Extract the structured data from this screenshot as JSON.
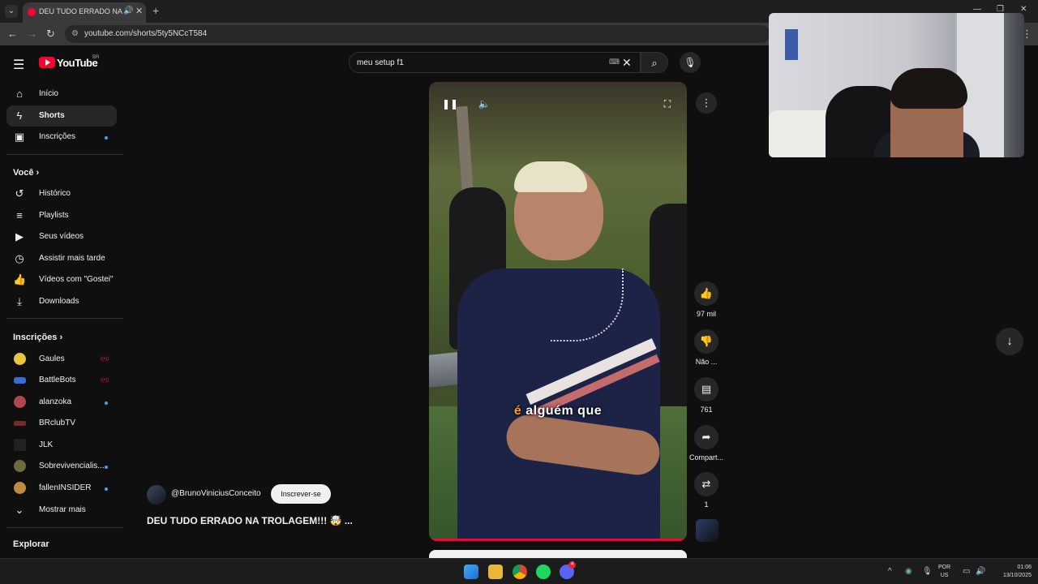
{
  "browser": {
    "tab_title": "DEU TUDO ERRADO NA TROLAGEM!!! - YouTube",
    "tab_title_visible": "DEU TUDO ERRADO NA TR",
    "url": "youtube.com/shorts/5ty5NCcT584"
  },
  "header": {
    "logo_text": "YouTube",
    "region": "BR",
    "search_query": "meu setup f1"
  },
  "sidebar": {
    "main_items": [
      {
        "label": "Início",
        "icon": "home-icon"
      },
      {
        "label": "Shorts",
        "icon": "shorts-icon",
        "active": true
      },
      {
        "label": "Inscrições",
        "icon": "subscriptions-icon",
        "dot": true
      }
    ],
    "you_heading": "Você",
    "you_items": [
      {
        "label": "Histórico",
        "icon": "history-icon"
      },
      {
        "label": "Playlists",
        "icon": "playlists-icon"
      },
      {
        "label": "Seus vídeos",
        "icon": "your-videos-icon"
      },
      {
        "label": "Assistir mais tarde",
        "icon": "watch-later-icon"
      },
      {
        "label": "Vídeos com \"Gostei\"",
        "icon": "liked-icon"
      },
      {
        "label": "Downloads",
        "icon": "downloads-icon"
      }
    ],
    "subs_heading": "Inscrições",
    "subscriptions": [
      {
        "label": "Gaules",
        "badge": "live",
        "color": "#e6c53a"
      },
      {
        "label": "BattleBots",
        "badge": "live",
        "color": "#3a6bd6"
      },
      {
        "label": "alanzoka",
        "badge": "dot",
        "color": "#b0474f"
      },
      {
        "label": "BRclubTV",
        "badge": "",
        "color": "#7a2a2a"
      },
      {
        "label": "JLK",
        "badge": "",
        "color": "#222222"
      },
      {
        "label": "Sobrevivencialis...",
        "badge": "dot",
        "color": "#6b6b40"
      },
      {
        "label": "fallenINSIDER",
        "badge": "dot",
        "color": "#c08a40"
      }
    ],
    "show_more": "Mostrar mais",
    "explore_heading": "Explorar"
  },
  "video": {
    "caption_highlight": "é",
    "caption_rest": "alguém que",
    "progress": 1.0
  },
  "actions": {
    "likes": "97 mil",
    "dislike_label": "Não ...",
    "comments": "761",
    "share_label": "Compart...",
    "remix_count": "1"
  },
  "channel": {
    "handle": "@BrunoViniciusConceito",
    "subscribe_label": "Inscrever-se",
    "title": "DEU TUDO ERRADO NA TROLAGEM!!! 🤯 ..."
  },
  "taskbar": {
    "lang_top": "POR",
    "lang_bottom": "US",
    "time": "01:06",
    "date": "13/10/2025",
    "discord_badge": "4"
  }
}
